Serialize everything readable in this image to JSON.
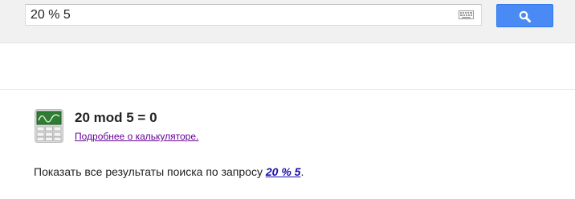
{
  "search": {
    "query": "20 % 5",
    "keyboard_icon": "keyboard-icon",
    "button_icon": "search-icon",
    "button_color": "#4a8af4"
  },
  "calculator": {
    "icon": "calculator-icon",
    "result": "20 mod 5 = 0",
    "more_link": "Подробнее о калькуляторе."
  },
  "show_all": {
    "prefix": "Показать все результаты поиска по запросу ",
    "query_link": "20 % 5",
    "suffix": "."
  }
}
